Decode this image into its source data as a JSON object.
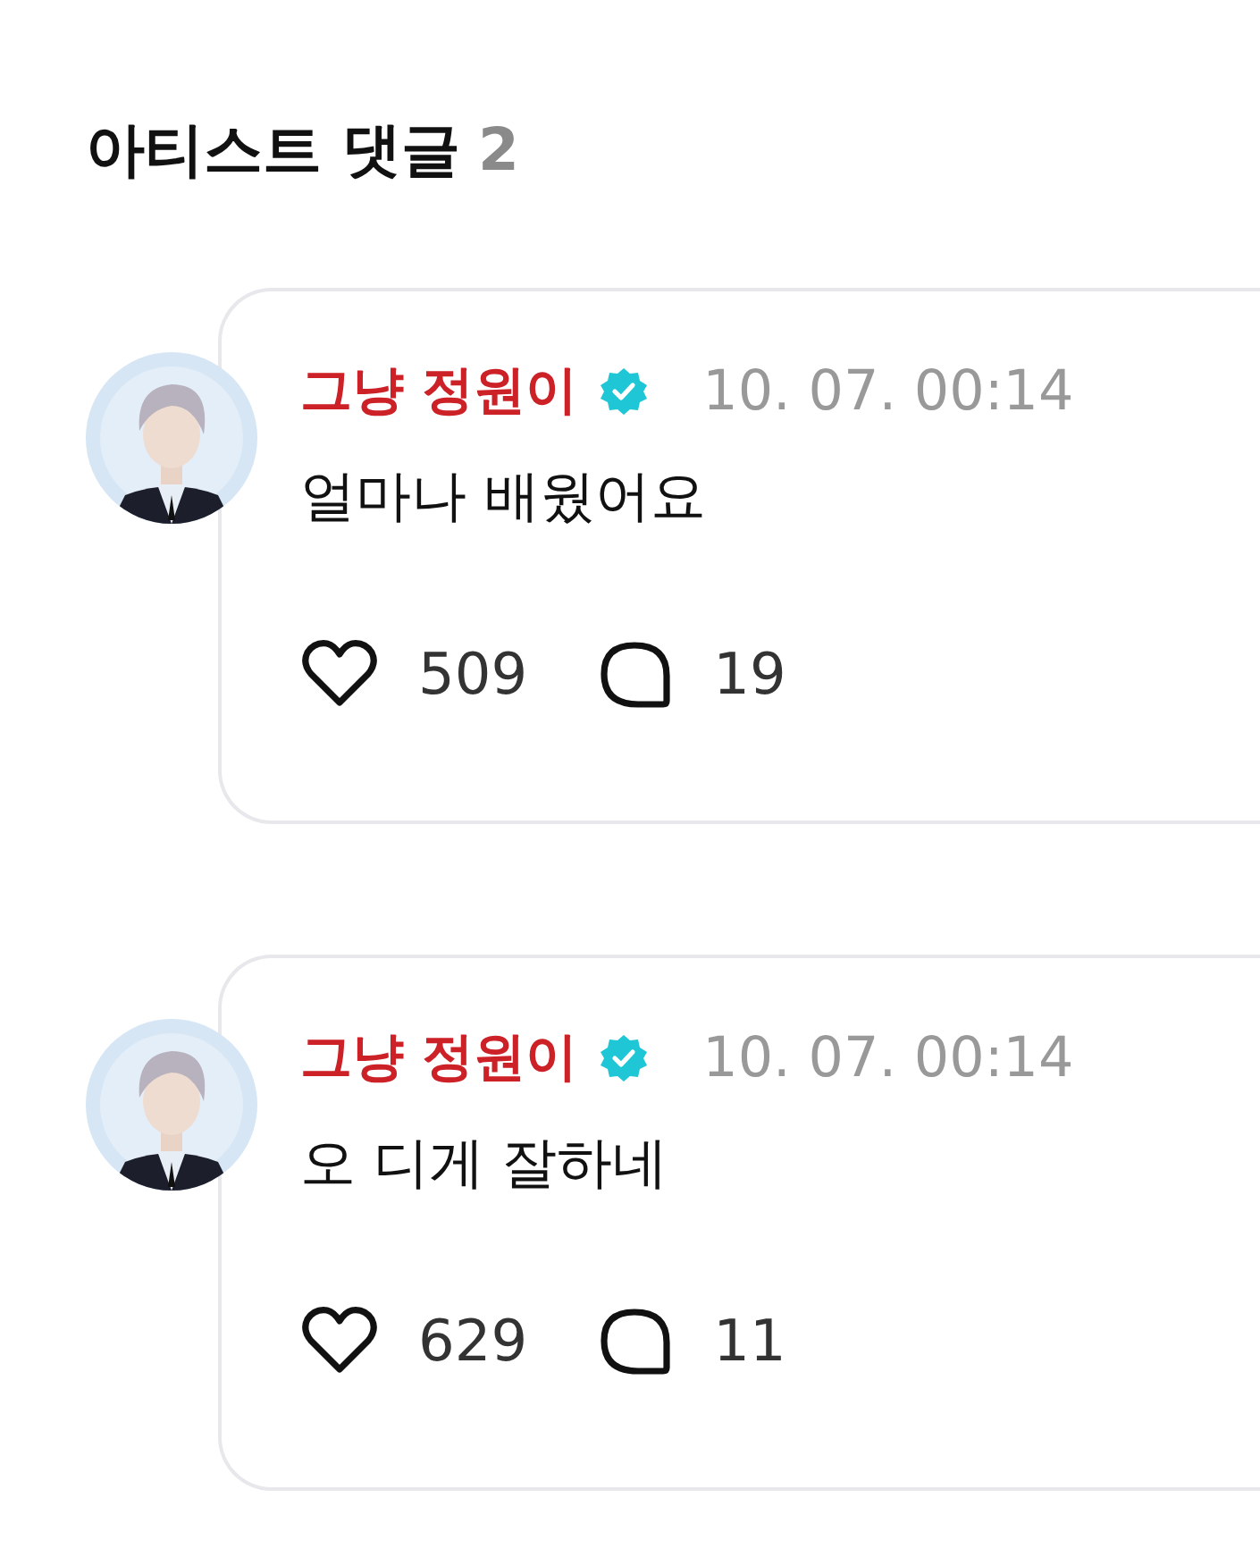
{
  "section": {
    "title": "아티스트 댓글",
    "count": "2"
  },
  "comments": [
    {
      "author": "그냥 정원이",
      "verified": true,
      "time": "10. 07. 00:14",
      "text": "얼마나 배웠어요",
      "likes": "509",
      "replies": "19"
    },
    {
      "author": "그냥 정원이",
      "verified": true,
      "time": "10. 07. 00:14",
      "text": "오 디게 잘하네",
      "likes": "629",
      "replies": "11"
    }
  ]
}
